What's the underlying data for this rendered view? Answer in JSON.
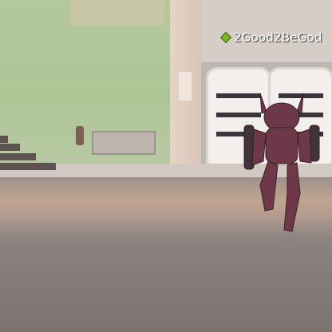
{
  "hud": {
    "player_tag": {
      "name": "2Good2BeGod",
      "marker_color": "#7bb51e"
    }
  }
}
